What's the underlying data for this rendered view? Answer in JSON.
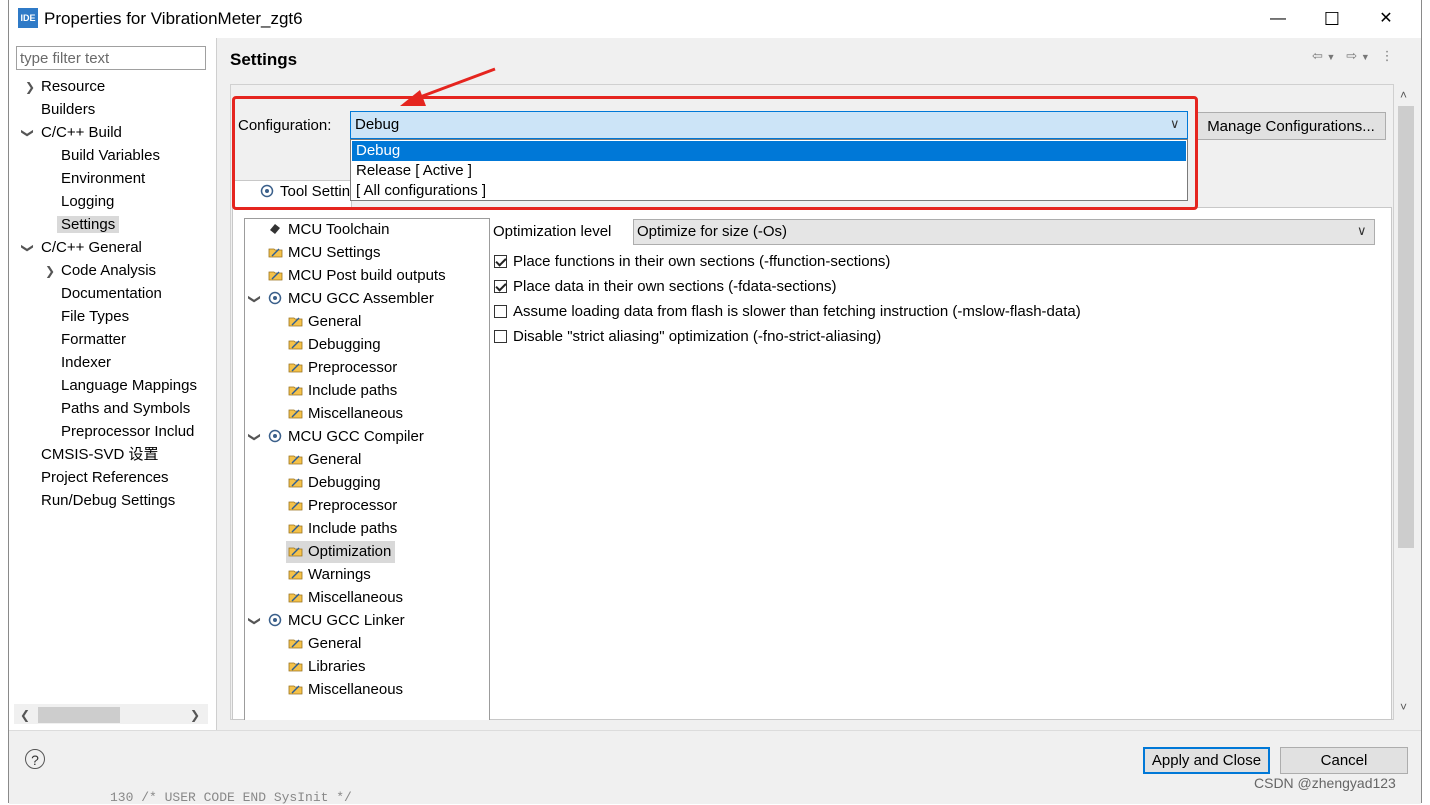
{
  "window": {
    "logo_text": "IDE",
    "title": "Properties for VibrationMeter_zgt6",
    "minimize_glyph": "—",
    "maximize_glyph": "☐",
    "close_glyph": "✕"
  },
  "filter": {
    "placeholder": "type filter text"
  },
  "left_tree": [
    {
      "label": "Resource"
    },
    {
      "label": "Builders"
    },
    {
      "label": "C/C++ Build"
    },
    {
      "label": "Build Variables"
    },
    {
      "label": "Environment"
    },
    {
      "label": "Logging"
    },
    {
      "label": "Settings"
    },
    {
      "label": "C/C++ General"
    },
    {
      "label": "Code Analysis"
    },
    {
      "label": "Documentation"
    },
    {
      "label": "File Types"
    },
    {
      "label": "Formatter"
    },
    {
      "label": "Indexer"
    },
    {
      "label": "Language Mappings"
    },
    {
      "label": "Paths and Symbols"
    },
    {
      "label": "Preprocessor Includ"
    },
    {
      "label": "CMSIS-SVD 设置"
    },
    {
      "label": "Project References"
    },
    {
      "label": "Run/Debug Settings"
    }
  ],
  "header": {
    "title": "Settings"
  },
  "configuration": {
    "label": "Configuration:",
    "selected": "Debug",
    "options": [
      "Debug",
      "Release  [ Active ]",
      "[ All configurations ]"
    ],
    "manage_label": "Manage Configurations..."
  },
  "tabs": {
    "tool_settings": "Tool Setting"
  },
  "inner_tree": [
    {
      "label": "MCU Toolchain"
    },
    {
      "label": "MCU Settings"
    },
    {
      "label": "MCU Post build outputs"
    },
    {
      "label": "MCU GCC Assembler"
    },
    {
      "label": "General"
    },
    {
      "label": "Debugging"
    },
    {
      "label": "Preprocessor"
    },
    {
      "label": "Include paths"
    },
    {
      "label": "Miscellaneous"
    },
    {
      "label": "MCU GCC Compiler"
    },
    {
      "label": "General"
    },
    {
      "label": "Debugging"
    },
    {
      "label": "Preprocessor"
    },
    {
      "label": "Include paths"
    },
    {
      "label": "Optimization"
    },
    {
      "label": "Warnings"
    },
    {
      "label": "Miscellaneous"
    },
    {
      "label": "MCU GCC Linker"
    },
    {
      "label": "General"
    },
    {
      "label": "Libraries"
    },
    {
      "label": "Miscellaneous"
    }
  ],
  "optimization": {
    "label": "Optimization level",
    "value": "Optimize for size (-Os)",
    "checkboxes": [
      {
        "label": "Place functions in their own sections (-ffunction-sections)",
        "checked": true
      },
      {
        "label": "Place data in their own sections (-fdata-sections)",
        "checked": true
      },
      {
        "label": "Assume loading data from flash is slower than fetching instruction (-mslow-flash-data)",
        "checked": false
      },
      {
        "label": "Disable \"strict aliasing\" optimization (-fno-strict-aliasing)",
        "checked": false
      }
    ]
  },
  "buttons": {
    "help": "?",
    "apply_close": "Apply and Close",
    "cancel": "Cancel"
  },
  "background_code": "130    /* USER CODE END SysInit */",
  "watermark": "CSDN @zhengyad123",
  "colors": {
    "highlight_red": "#e5251f",
    "selection_blue": "#0078d7",
    "select_bg": "#cce4f7"
  }
}
